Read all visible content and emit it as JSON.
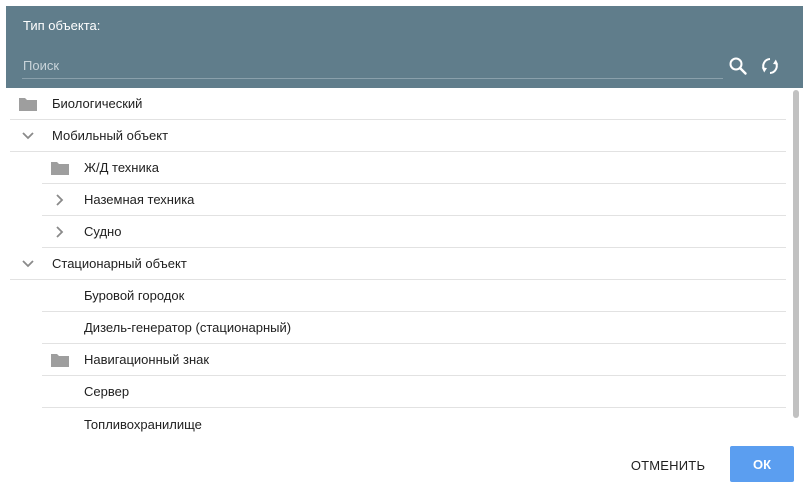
{
  "header": {
    "title": "Тип объекта:",
    "search_placeholder": "Поиск",
    "search_value": "",
    "search_icon": "search-icon",
    "refresh_icon": "refresh-icon"
  },
  "tree": {
    "items": [
      {
        "label": "Биологический",
        "icon": "folder-icon",
        "level": 0
      },
      {
        "label": "Мобильный объект",
        "icon": "chevron-down-icon",
        "level": 0
      },
      {
        "label": "Ж/Д техника",
        "icon": "folder-icon",
        "level": 1
      },
      {
        "label": "Наземная техника",
        "icon": "chevron-right-icon",
        "level": 1
      },
      {
        "label": "Судно",
        "icon": "chevron-right-icon",
        "level": 1
      },
      {
        "label": "Стационарный объект",
        "icon": "chevron-down-icon",
        "level": 0
      },
      {
        "label": "Буровой городок",
        "icon": "",
        "level": 1
      },
      {
        "label": "Дизель-генератор (стационарный)",
        "icon": "",
        "level": 1
      },
      {
        "label": "Навигационный знак",
        "icon": "folder-icon",
        "level": 1
      },
      {
        "label": "Сервер",
        "icon": "",
        "level": 1
      },
      {
        "label": "Топливохранилище",
        "icon": "",
        "level": 1
      }
    ]
  },
  "footer": {
    "cancel_label": "ОТМЕНИТЬ",
    "ok_label": "ОК"
  },
  "colors": {
    "header_bg": "#607d8b",
    "ok_bg": "#5b9ef0",
    "folder": "#9e9e9e"
  }
}
